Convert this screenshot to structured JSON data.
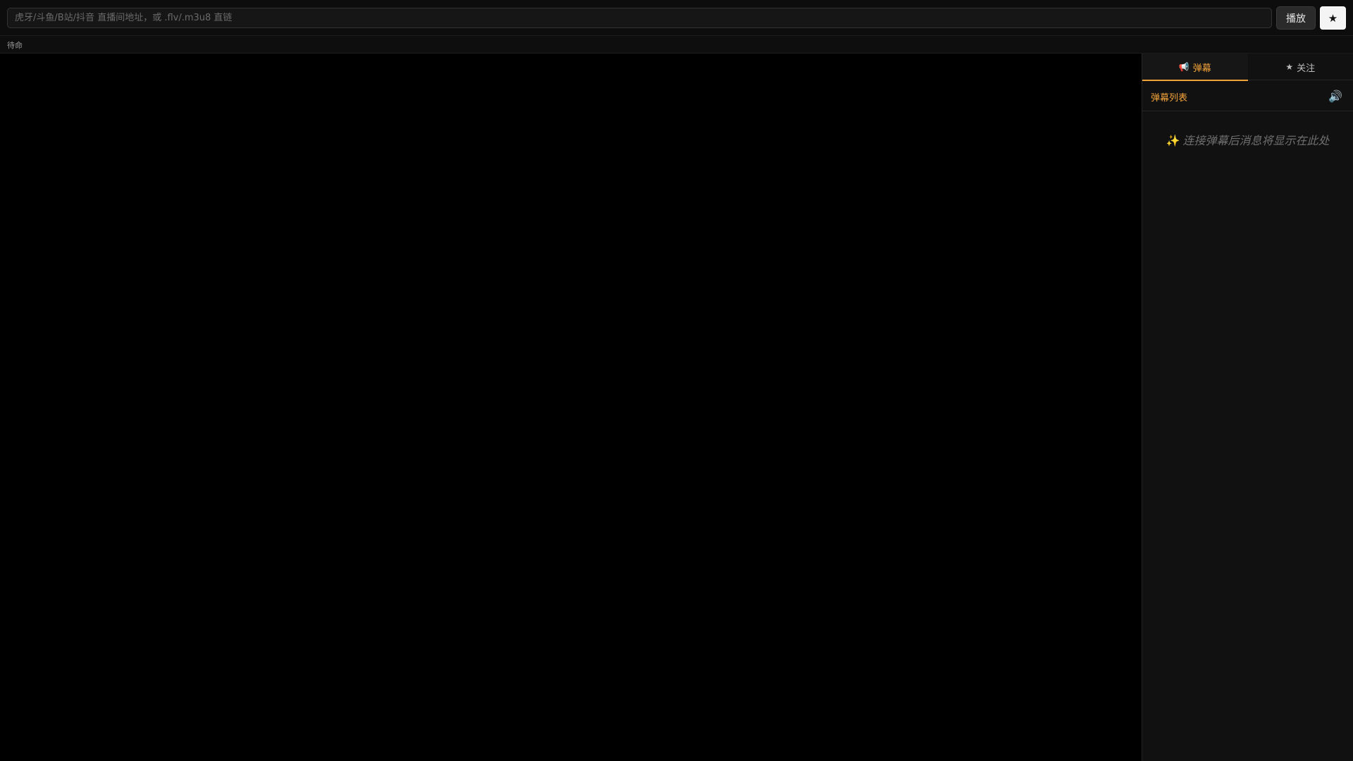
{
  "topbar": {
    "url_placeholder": "虎牙/斗鱼/B站/抖音 直播间地址，或 .flv/.m3u8 直链",
    "url_value": "",
    "play_label": "播放",
    "favorite_symbol": "★"
  },
  "status": {
    "text": "待命"
  },
  "sidebar": {
    "tabs": [
      {
        "icon": "📢",
        "icon_name": "megaphone-icon",
        "label": "弹幕",
        "active": true
      },
      {
        "icon": "★",
        "icon_name": "star-icon",
        "label": "关注",
        "active": false
      }
    ],
    "list_title": "弹幕列表",
    "sound_icon": "🔊",
    "empty_icon": "✨",
    "empty_text": "连接弹幕后消息将显示在此处"
  },
  "colors": {
    "accent": "#f2a33a",
    "background": "#000000",
    "panel": "#111111"
  }
}
